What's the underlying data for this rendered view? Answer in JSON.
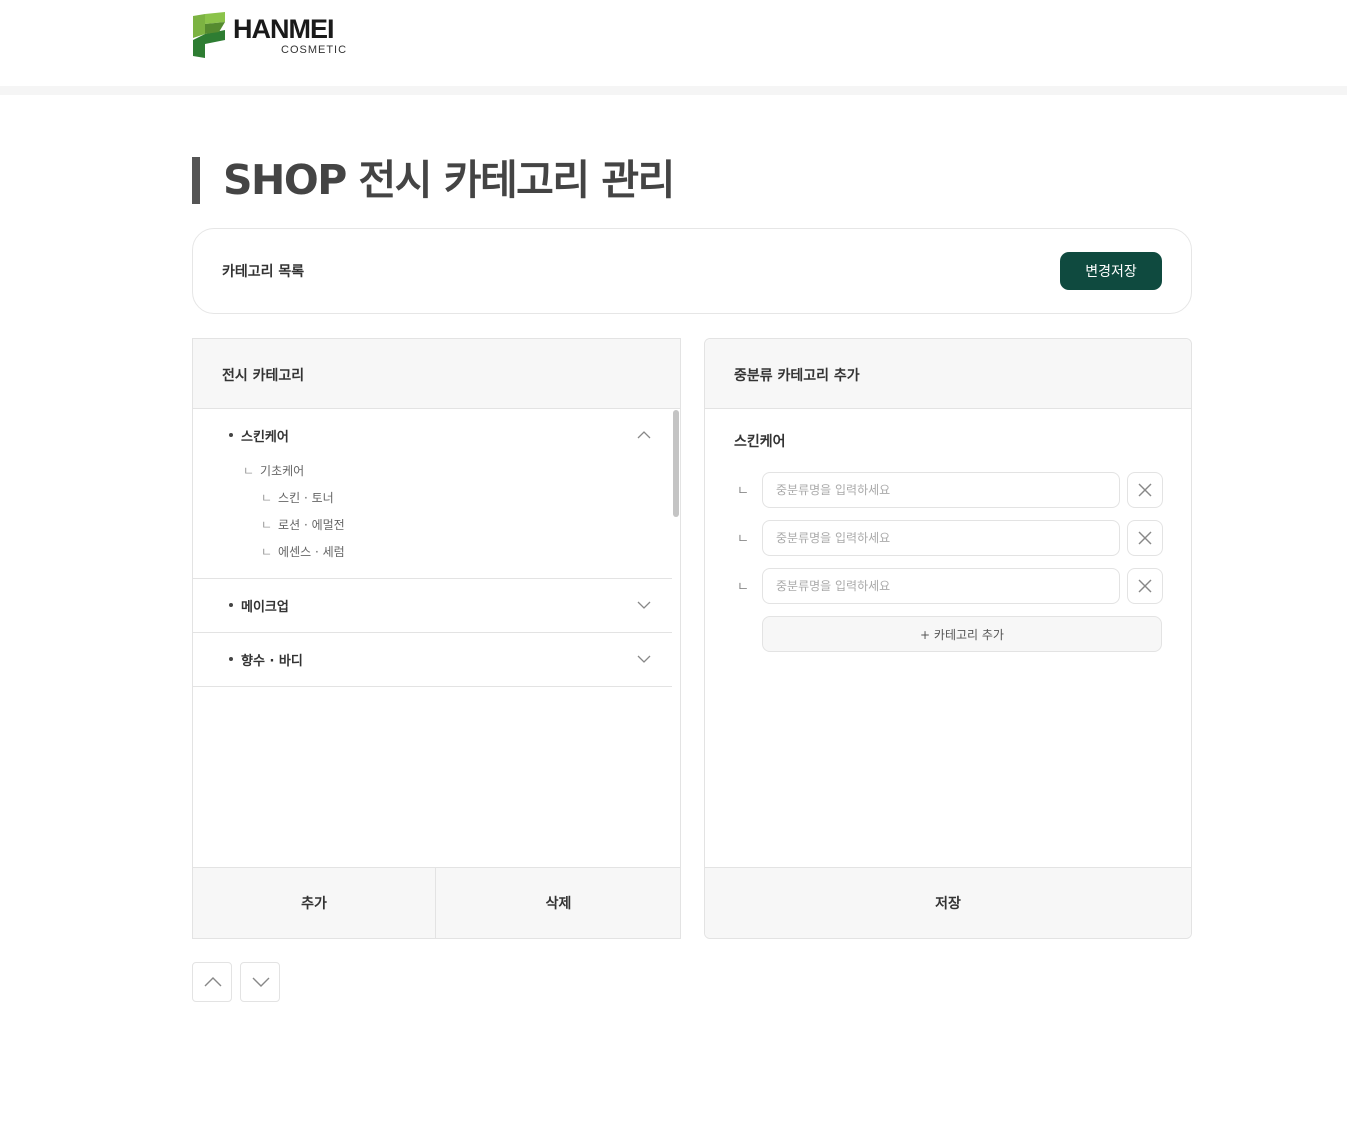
{
  "brand": {
    "name": "HANMEI",
    "subtitle": "COSMETIC",
    "mark_colors": [
      "#2e7d32",
      "#8bc34a"
    ]
  },
  "page": {
    "title": "SHOP 전시 카테고리 관리"
  },
  "toolbar": {
    "label": "카테고리 목록",
    "save_changes_label": "변경저장",
    "accent_color": "#0f4a3f"
  },
  "left_panel": {
    "title": "전시 카테고리",
    "groups": [
      {
        "label": "스킨케어",
        "expanded": true,
        "chevron": "chevron-up-icon",
        "children": [
          {
            "label": "기초케어",
            "level": 1
          },
          {
            "label": "스킨 · 토너",
            "level": 2
          },
          {
            "label": "로션 · 에멀전",
            "level": 2
          },
          {
            "label": "에센스 · 세럼",
            "level": 2
          }
        ]
      },
      {
        "label": "메이크업",
        "expanded": false,
        "chevron": "chevron-down-icon"
      },
      {
        "label": "향수 · 바디",
        "expanded": false,
        "chevron": "chevron-down-icon"
      }
    ],
    "corner_glyph": "ㄴ",
    "add_label": "추가",
    "delete_label": "삭제"
  },
  "right_panel": {
    "title": "중분류 카테고리 추가",
    "parent_label": "스킨케어",
    "corner_glyph": "ㄴ",
    "rows": [
      {
        "value": "",
        "placeholder": "중분류명을 입력하세요"
      },
      {
        "value": "",
        "placeholder": "중분류명을 입력하세요"
      },
      {
        "value": "",
        "placeholder": "중분류명을 입력하세요"
      }
    ],
    "add_category_label": "+ 카테고리 추가",
    "save_label": "저장"
  },
  "order_controls": {
    "up_icon": "chevron-up-icon",
    "down_icon": "chevron-down-icon"
  }
}
